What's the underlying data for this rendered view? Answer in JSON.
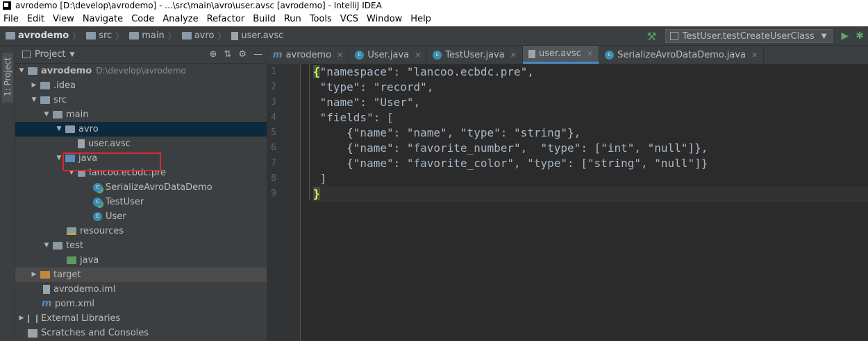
{
  "window": {
    "title": "avrodemo [D:\\develop\\avrodemo] - ...\\src\\main\\avro\\user.avsc [avrodemo] - IntelliJ IDEA"
  },
  "menu": [
    "File",
    "Edit",
    "View",
    "Navigate",
    "Code",
    "Analyze",
    "Refactor",
    "Build",
    "Run",
    "Tools",
    "VCS",
    "Window",
    "Help"
  ],
  "breadcrumb": [
    "avrodemo",
    "src",
    "main",
    "avro",
    "user.avsc"
  ],
  "run_config": {
    "label": "TestUser.testCreateUserClass"
  },
  "side_stripe": {
    "label": "1: Project"
  },
  "project_panel": {
    "title": "Project",
    "tree": [
      {
        "label": "avrodemo",
        "path": "D:\\develop\\avrodemo"
      },
      {
        "label": ".idea"
      },
      {
        "label": "src"
      },
      {
        "label": "main"
      },
      {
        "label": "avro"
      },
      {
        "label": "user.avsc"
      },
      {
        "label": "java"
      },
      {
        "label": "lancoo.ecbdc.pre"
      },
      {
        "label": "SerializeAvroDataDemo"
      },
      {
        "label": "TestUser"
      },
      {
        "label": "User"
      },
      {
        "label": "resources"
      },
      {
        "label": "test"
      },
      {
        "label": "java"
      },
      {
        "label": "target"
      },
      {
        "label": "avrodemo.iml"
      },
      {
        "label": "pom.xml"
      },
      {
        "label": "External Libraries"
      },
      {
        "label": "Scratches and Consoles"
      }
    ]
  },
  "editor": {
    "tabs": [
      {
        "label": "avrodemo"
      },
      {
        "label": "User.java"
      },
      {
        "label": "TestUser.java"
      },
      {
        "label": "user.avsc"
      },
      {
        "label": "SerializeAvroDataDemo.java"
      }
    ],
    "line_numbers": [
      "1",
      "2",
      "3",
      "4",
      "5",
      "6",
      "7",
      "8",
      "9"
    ],
    "code": [
      "\"namespace\": \"lancoo.ecbdc.pre\",",
      " \"type\": \"record\",",
      " \"name\": \"User\",",
      " \"fields\": [",
      "     {\"name\": \"name\", \"type\": \"string\"},",
      "     {\"name\": \"favorite_number\",  \"type\": [\"int\", \"null\"]},",
      "     {\"name\": \"favorite_color\", \"type\": [\"string\", \"null\"]}",
      " ]",
      ""
    ],
    "open_brace": "{",
    "close_brace": "}"
  },
  "colors": {
    "accent": "#4a88c7",
    "highlight_box": "#e0262a",
    "selection": "#0d293e"
  }
}
